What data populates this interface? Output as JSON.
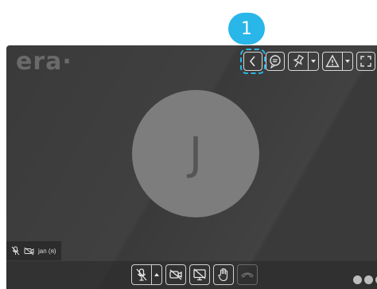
{
  "step_badge": "1",
  "logo": {
    "text": "era·"
  },
  "toolbar_top": {
    "items": [
      {
        "name": "collapse-button",
        "icon": "chevron-left-icon",
        "highlighted": true
      },
      {
        "name": "chat-button",
        "icon": "chat-bubble-icon"
      },
      {
        "name": "pin-button",
        "icon": "pin-icon",
        "has_dropdown": true
      },
      {
        "name": "alert-button",
        "icon": "warning-triangle-icon",
        "has_dropdown": true
      },
      {
        "name": "fullscreen-button",
        "icon": "fullscreen-icon"
      }
    ]
  },
  "avatar": {
    "initial": "J",
    "color": "#7d7d7d"
  },
  "participant": {
    "name": "jan (я)",
    "mic_icon": "mic-muted-icon",
    "camera_icon": "camera-off-icon"
  },
  "bottom_controls": [
    {
      "name": "mic-toggle",
      "icon": "mic-muted-icon",
      "has_dropdown": true
    },
    {
      "name": "camera-toggle",
      "icon": "camera-off-icon"
    },
    {
      "name": "screen-share-toggle",
      "icon": "screen-share-off-icon"
    },
    {
      "name": "raise-hand-button",
      "icon": "hand-icon"
    },
    {
      "name": "hang-up-button",
      "icon": "phone-hangup-icon",
      "disabled": true
    }
  ],
  "colors": {
    "accent": "#29b6e8",
    "stage_bg": "#3a3a3a",
    "avatar": "#7d7d7d"
  }
}
